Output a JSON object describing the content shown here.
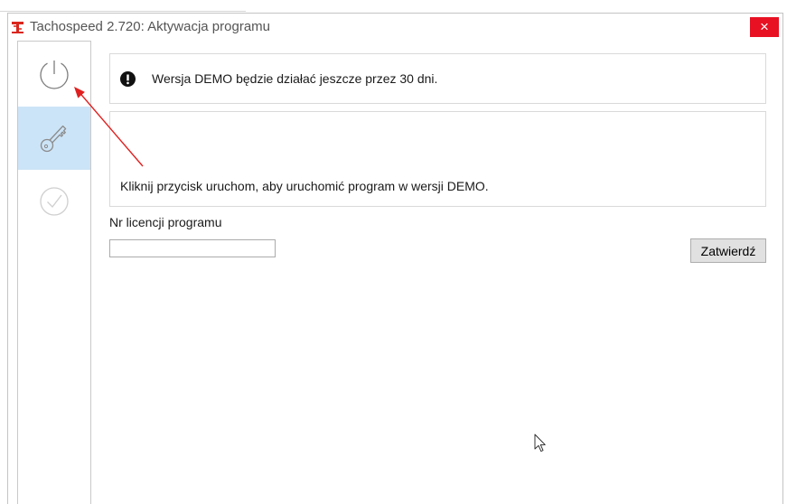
{
  "window": {
    "title": "Tachospeed 2.720: Aktywacja programu",
    "close_label": "×",
    "logo_icon": "tachospeed-logo-icon"
  },
  "sidebar": {
    "items": [
      {
        "icon": "power-icon",
        "selected": false
      },
      {
        "icon": "key-icon",
        "selected": true
      },
      {
        "icon": "check-circle-icon",
        "selected": false
      }
    ]
  },
  "notice": {
    "icon": "exclamation-circle-icon",
    "text": "Wersja DEMO będzie działać jeszcze przez 30 dni."
  },
  "info": {
    "text": "Kliknij przycisk uruchom, aby uruchomić program w wersji DEMO."
  },
  "license": {
    "label": "Nr licencji programu",
    "value": "",
    "submit_label": "Zatwierdź"
  },
  "annotation": {
    "icon": "annotation-arrow-icon"
  },
  "cursor": {
    "icon": "mouse-cursor-icon"
  },
  "colors": {
    "close_button": "#e81123",
    "selected_item": "#cce4f7",
    "annotation_arrow": "#e02020",
    "logo": "#d9261c"
  }
}
